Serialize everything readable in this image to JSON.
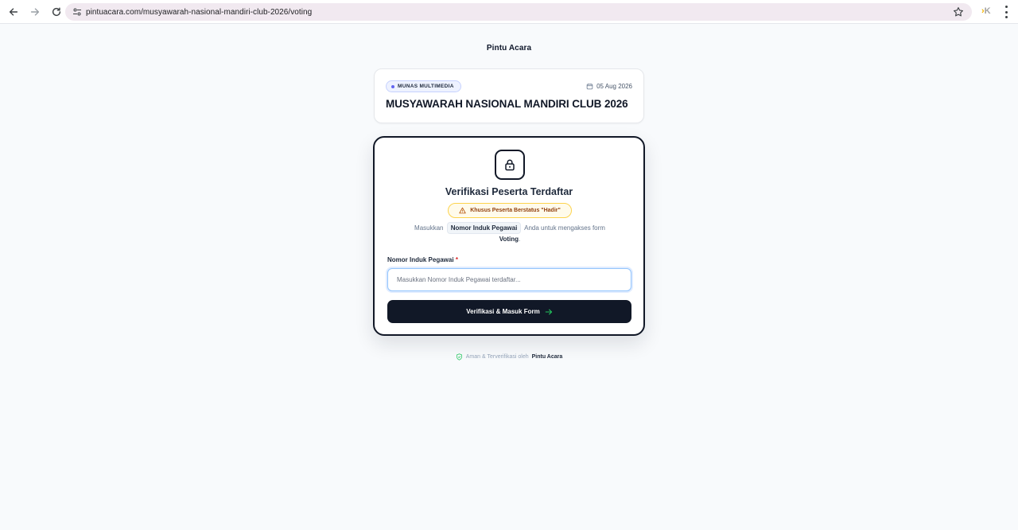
{
  "browser": {
    "url": "pintuacara.com/musyawarah-nasional-mandiri-club-2026/voting",
    "extension_label": "K"
  },
  "page": {
    "brand": "Pintu Acara"
  },
  "event": {
    "category": "MUNAS MULTIMEDIA",
    "date": "05 Aug 2026",
    "title": "MUSYAWARAH NASIONAL MANDIRI CLUB 2026"
  },
  "verify": {
    "title": "Verifikasi Peserta Terdaftar",
    "notice": "Khusus Peserta Berstatus \"Hadir\"",
    "instruction_prefix": "Masukkan",
    "instruction_highlight": "Nomor Induk Pegawai",
    "instruction_middle": "Anda untuk mengakses form",
    "instruction_form": "Voting",
    "instruction_suffix": ".",
    "field_label": "Nomor Induk Pegawai",
    "field_required_mark": "*",
    "input_value": "",
    "input_placeholder": "Masukkan Nomor Induk Pegawai terdaftar...",
    "submit_label": "Verifikasi & Masuk Form"
  },
  "footer": {
    "note": "Aman & Terverifikasi oleh",
    "brand": "Pintu Acara"
  },
  "colors": {
    "primary_dark": "#111827",
    "warning_bg": "#fffbeb",
    "warning_text": "#92400e",
    "accent_green": "#22c55e",
    "badge_blue": "#6366f1"
  },
  "icons": {
    "back": "back-arrow-icon",
    "forward": "forward-arrow-icon",
    "reload": "reload-icon",
    "site_info": "tune-icon",
    "bookmark": "star-icon",
    "menu": "kebab-menu-icon",
    "calendar": "calendar-icon",
    "lock": "lock-icon",
    "warning": "warning-triangle-icon",
    "arrow_right": "arrow-right-icon",
    "shield": "shield-check-icon"
  }
}
